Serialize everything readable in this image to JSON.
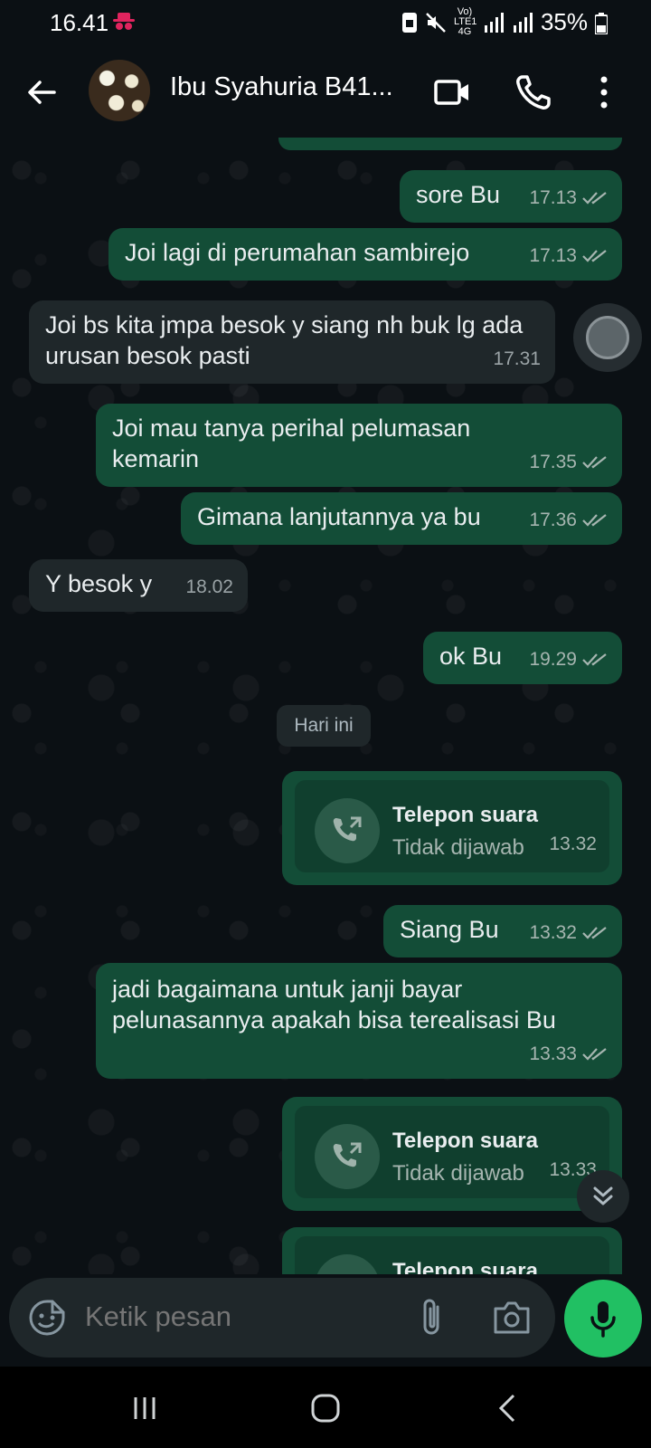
{
  "status_bar": {
    "time": "16.41",
    "network_labels": "Vo) LTE1 4G",
    "battery": "35%"
  },
  "header": {
    "contact_name": "Ibu Syahuria B41...",
    "icons": [
      "back-arrow-icon",
      "video-call-icon",
      "phone-icon",
      "more-options-icon"
    ]
  },
  "messages": [
    {
      "dir": "out",
      "text": "sore Bu",
      "time": "17.13",
      "ticks": true
    },
    {
      "dir": "out",
      "text": "Joi lagi di perumahan sambirejo",
      "time": "17.13",
      "ticks": true
    },
    {
      "dir": "in",
      "text": "Joi bs kita jmpa besok y siang nh buk lg ada urusan besok pasti",
      "time": "17.31"
    },
    {
      "dir": "out",
      "text": "Joi mau tanya perihal pelumasan kemarin",
      "time": "17.35",
      "ticks": true
    },
    {
      "dir": "out",
      "text": "Gimana lanjutannya ya bu",
      "time": "17.36",
      "ticks": true
    },
    {
      "dir": "in",
      "text": "Y besok y",
      "time": "18.02"
    },
    {
      "dir": "out",
      "text": "ok Bu",
      "time": "19.29",
      "ticks": true
    }
  ],
  "day_separator": "Hari ini",
  "today": [
    {
      "type": "call",
      "title": "Telepon suara",
      "subtitle": "Tidak dijawab",
      "time": "13.32"
    },
    {
      "dir": "out",
      "text": "Siang Bu",
      "time": "13.32",
      "ticks": true
    },
    {
      "dir": "out",
      "text": "jadi bagaimana untuk janji bayar pelunasannya apakah bisa terealisasi Bu",
      "time": "13.33",
      "ticks": true
    },
    {
      "type": "call",
      "title": "Telepon suara",
      "subtitle": "Tidak dijawab",
      "time": "13.33"
    },
    {
      "type": "call",
      "title": "Telepon suara",
      "subtitle": "",
      "time": ""
    }
  ],
  "composer": {
    "placeholder": "Ketik pesan"
  },
  "colors": {
    "background": "#0b1014",
    "outgoing_bubble": "#134d37",
    "incoming_bubble": "#1f272a",
    "accent_green": "#21c063"
  }
}
